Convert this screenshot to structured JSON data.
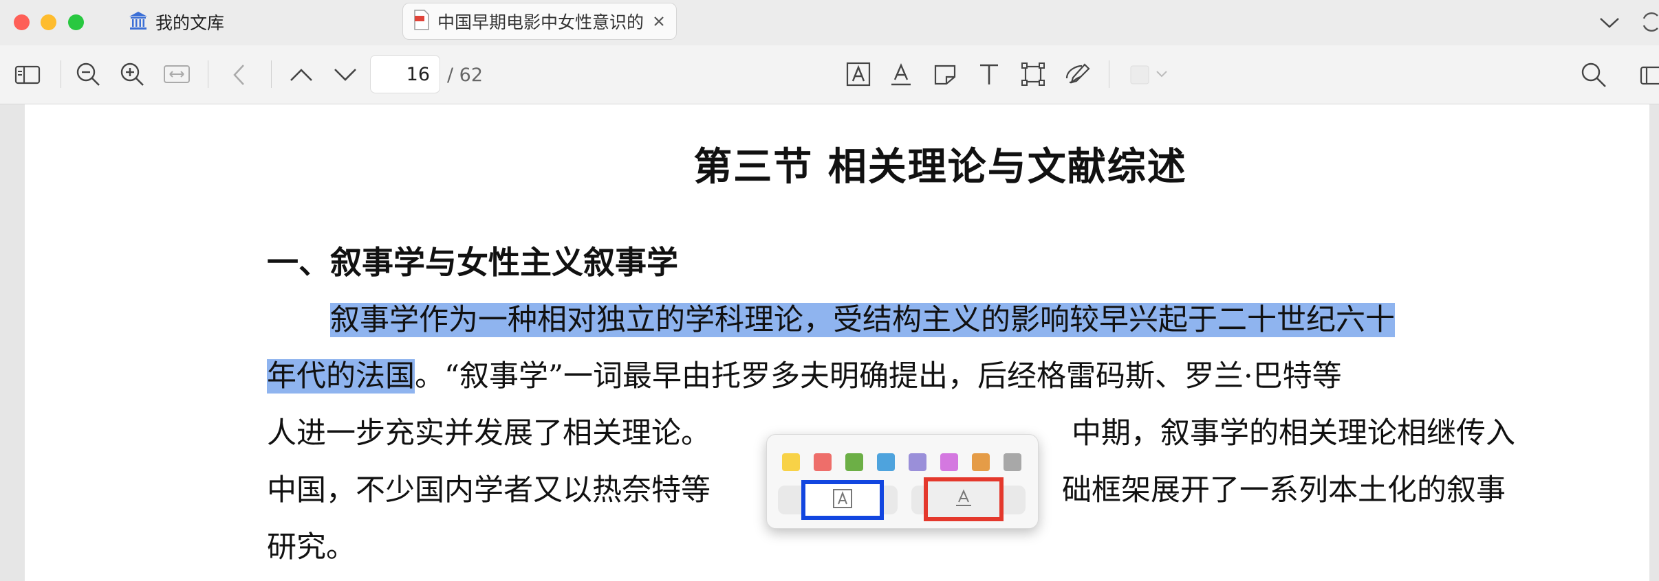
{
  "tabs": {
    "library_label": "我的文库",
    "document_label": "中国早期电影中女性意识的"
  },
  "toolbar": {
    "current_page": "16",
    "total_pages": "/ 62"
  },
  "document": {
    "section_title": "第三节  相关理论与文献综述",
    "subsection_title": "一、叙事学与女性主义叙事学",
    "lines": [
      {
        "highlight": "叙事学作为一种相对独立的学科理论，受结构主义的影响较早兴起于二十世纪六十",
        "rest": ""
      },
      {
        "highlight": "年代的法国",
        "rest": "。“叙事学”一词最早由托罗多夫明确提出，后经格雷码斯、罗兰·巴特等"
      },
      {
        "highlight": "",
        "rest": "人进一步充实并发展了相关理论。"
      },
      {
        "highlight": "",
        "rest": "中国，不少国内学者又以热奈特等"
      },
      {
        "highlight": "",
        "rest": "研究。"
      }
    ],
    "right_fragments": {
      "line3": "中期，叙事学的相关理论相继传入",
      "line4": "础框架展开了一系列本土化的叙事"
    }
  },
  "annotation_popup": {
    "colors": [
      "#f8d247",
      "#ee6e6a",
      "#6caf46",
      "#4ea3dd",
      "#9a8fd9",
      "#d478e0",
      "#e59c47",
      "#a8a8a8"
    ]
  }
}
